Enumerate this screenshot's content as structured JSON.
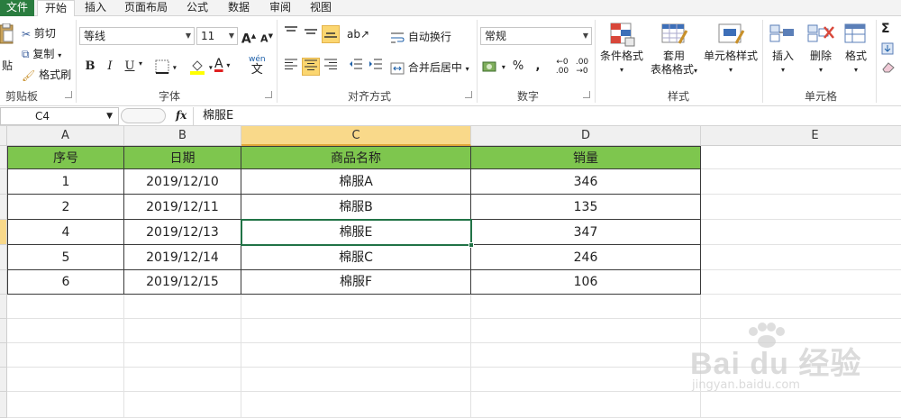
{
  "menu": {
    "tabs": [
      "文件",
      "开始",
      "插入",
      "页面布局",
      "公式",
      "数据",
      "审阅",
      "视图"
    ],
    "active": "开始"
  },
  "ribbon": {
    "clipboard": {
      "paste_label": "贴",
      "cut_label": "剪切",
      "copy_label": "复制",
      "format_painter_label": "格式刷",
      "group_label": "剪贴板"
    },
    "font": {
      "font_name": "等线",
      "font_size": "11",
      "bold": "B",
      "italic": "I",
      "underline": "U",
      "grow": "A",
      "shrink": "A",
      "font_color_glyph": "A",
      "phonetic": "wén",
      "group_label": "字体"
    },
    "alignment": {
      "wrap_text_label": "自动换行",
      "merge_center_label": "合并后居中",
      "group_label": "对齐方式"
    },
    "number": {
      "format": "常规",
      "percent": "%",
      "comma": ",",
      "group_label": "数字"
    },
    "styles": {
      "conditional_label": "条件格式",
      "table_format_label_1": "套用",
      "table_format_label_2": "表格格式",
      "cell_styles_label": "单元格样式",
      "group_label": "样式"
    },
    "cells": {
      "insert_label": "插入",
      "delete_label": "删除",
      "format_label": "格式",
      "group_label": "单元格"
    },
    "editing": {
      "sum_glyph": "Σ"
    }
  },
  "formula_bar": {
    "name_box": "C4",
    "fx": "fx",
    "content": "棉服E"
  },
  "sheet": {
    "columns": [
      "A",
      "B",
      "C",
      "D",
      "E"
    ],
    "selected_column": "C",
    "header_row": [
      "序号",
      "日期",
      "商品名称",
      "销量"
    ],
    "rows": [
      [
        "1",
        "2019/12/10",
        "棉服A",
        "346"
      ],
      [
        "2",
        "2019/12/11",
        "棉服B",
        "135"
      ],
      [
        "4",
        "2019/12/13",
        "棉服E",
        "347"
      ],
      [
        "5",
        "2019/12/14",
        "棉服C",
        "246"
      ],
      [
        "6",
        "2019/12/15",
        "棉服F",
        "106"
      ]
    ],
    "selected_cell": "C4",
    "header_fill": "#7ec64e",
    "selection_color": "#217346"
  },
  "watermark": {
    "brand": "Bai du 经验",
    "url": "jingyan.baidu.com"
  }
}
